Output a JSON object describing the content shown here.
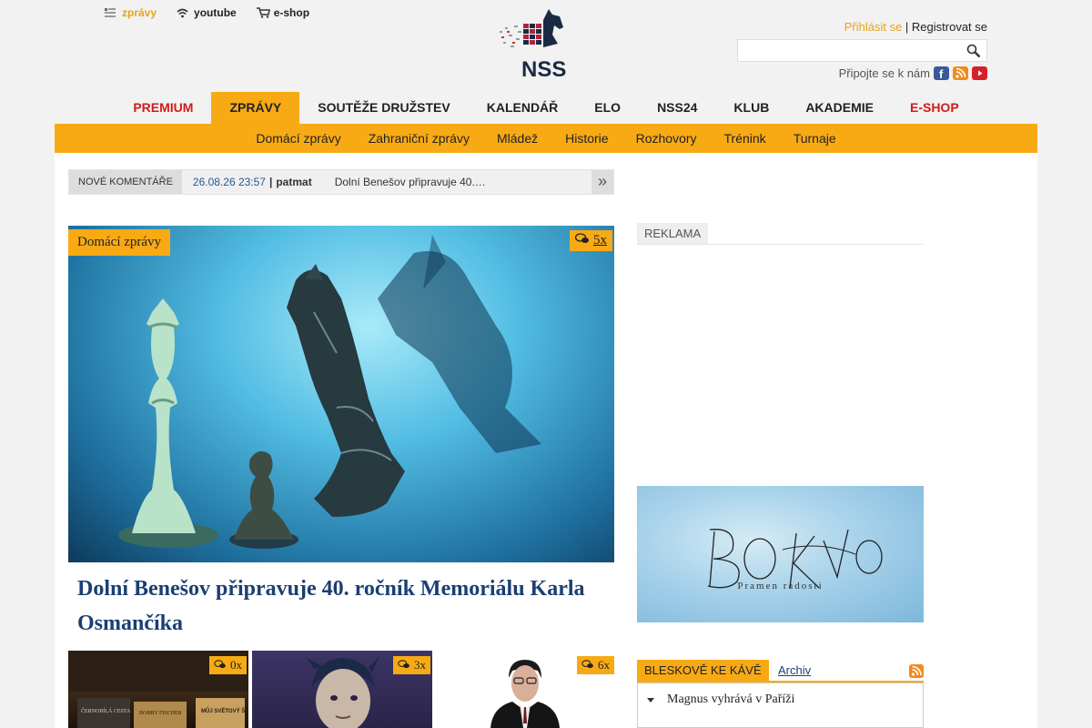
{
  "top_links": [
    {
      "label": "zprávy",
      "icon": "news-icon",
      "active": true
    },
    {
      "label": "youtube",
      "icon": "wifi-icon",
      "active": false
    },
    {
      "label": "e-shop",
      "icon": "cart-icon",
      "active": false
    }
  ],
  "logo_text": "NSS",
  "auth": {
    "login": "Přihlásit se",
    "separator": " | ",
    "register": "Registrovat se"
  },
  "search": {
    "placeholder": ""
  },
  "connect": {
    "label": "Připojte se k nám",
    "icons": [
      "facebook-icon",
      "rss-icon",
      "youtube-icon"
    ]
  },
  "main_nav": [
    {
      "label": "PREMIUM",
      "style": "red"
    },
    {
      "label": "ZPRÁVY",
      "style": "active"
    },
    {
      "label": "SOUTĚŽE DRUŽSTEV",
      "style": ""
    },
    {
      "label": "KALENDÁŘ",
      "style": ""
    },
    {
      "label": "ELO",
      "style": ""
    },
    {
      "label": "NSS24",
      "style": ""
    },
    {
      "label": "KLUB",
      "style": ""
    },
    {
      "label": "AKADEMIE",
      "style": ""
    },
    {
      "label": "E-SHOP",
      "style": "red"
    }
  ],
  "sub_nav": [
    "Domácí zprávy",
    "Zahraniční zprávy",
    "Mládež",
    "Historie",
    "Rozhovory",
    "Trénink",
    "Turnaje"
  ],
  "comments": {
    "label": "NOVÉ KOMENTÁŘE",
    "date": "26.08.26 23:57",
    "sep": "|",
    "user": "patmat",
    "text": "Dolní Benešov připravuje 40.…",
    "more": "»"
  },
  "hero": {
    "category": "Domácí zprávy",
    "comment_count": "5x",
    "headline": "Dolní Benešov připravuje 40. ročník Memoriálu Karla Osmančíka"
  },
  "thumbs": [
    {
      "count": "0x",
      "book_texts": [
        "ČERNOBÍLÁ CESTA",
        "BOBBY FISCHER",
        "MŮJ SVĚTOVÝ ŠACH"
      ]
    },
    {
      "count": "3x"
    },
    {
      "count": "6x"
    }
  ],
  "ad": {
    "label": "REKLAMA",
    "banner_subtitle": "Pramen radosti"
  },
  "blesk": {
    "tab": "BLESKOVĚ KE KÁVĚ",
    "archive": "Archiv",
    "items": [
      "Magnus vyhrává v Paříži"
    ]
  },
  "colors": {
    "accent": "#f8aa15",
    "red": "#d21a1a",
    "link": "#1a3f73",
    "page_bg": "#f2f2f2"
  }
}
